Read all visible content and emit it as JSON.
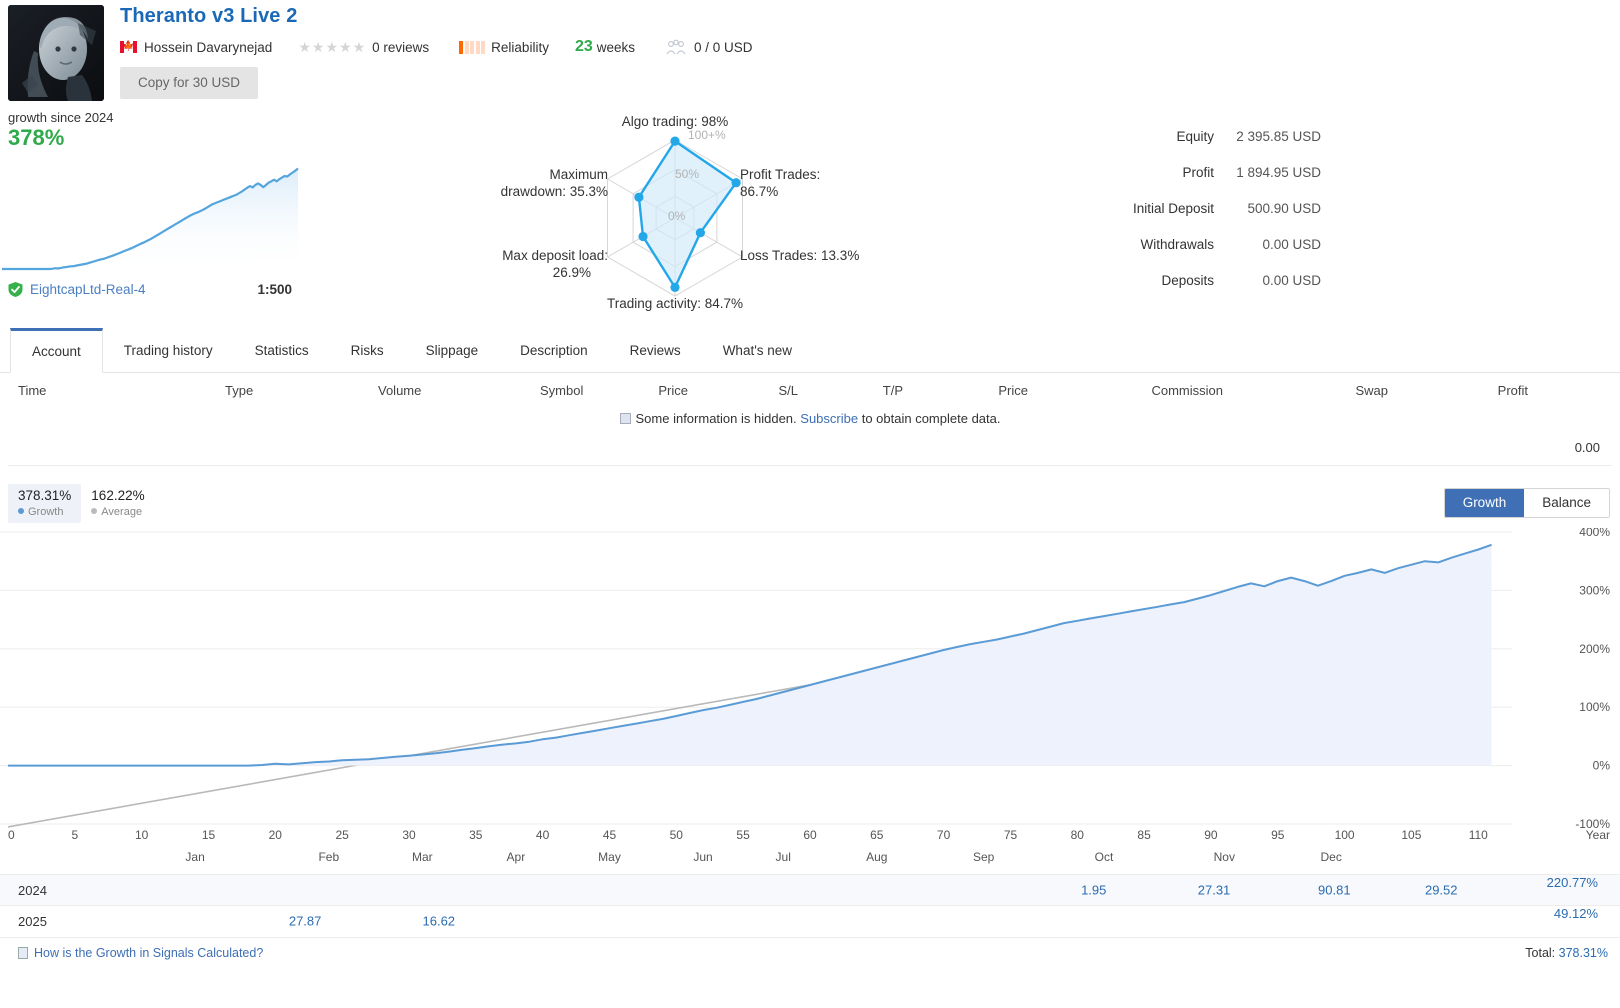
{
  "header": {
    "title": "Theranto v3 Live 2",
    "author": "Hossein Davarynejad",
    "country_flag": "canada-flag",
    "reviews": "0 reviews",
    "stars": 0,
    "reliability_label": "Reliability",
    "reliability_filled": 1,
    "reliability_total": 5,
    "weeks_number": "23",
    "weeks_label": "weeks",
    "subscribers": "0 / 0 USD",
    "copy_button": "Copy for 30 USD"
  },
  "growth_mini": {
    "caption": "growth since 2024",
    "value": "378%",
    "broker": "EightcapLtd-Real-4",
    "leverage": "1:500"
  },
  "radar": {
    "ring_labels": [
      "100+%",
      "50%",
      "0%"
    ],
    "axes": [
      {
        "name": "Algo trading",
        "label": "Algo trading: 98%",
        "value": 98
      },
      {
        "name": "Profit Trades",
        "label": "Profit Trades:",
        "label2": "86.7%",
        "value": 86.7
      },
      {
        "name": "Loss Trades",
        "label": "Loss Trades: 13.3%",
        "value": 13.3
      },
      {
        "name": "Trading activity",
        "label": "Trading activity: 84.7%",
        "value": 84.7
      },
      {
        "name": "Max deposit load",
        "label": "Max deposit load:",
        "label2": "26.9%",
        "value": 26.9
      },
      {
        "name": "Maximum drawdown",
        "label": "Maximum",
        "label2": "drawdown: 35.3%",
        "value": 35.3
      }
    ]
  },
  "equity": {
    "rows": [
      {
        "label": "Equity",
        "value": "2 395.85 USD",
        "pct": 100,
        "tone": "dark"
      },
      {
        "label": "Profit",
        "value": "1 894.95 USD",
        "pct": 72,
        "tone": "dark"
      },
      {
        "label": "Initial Deposit",
        "value": "500.90 USD",
        "pct": 20,
        "tone": "light"
      },
      {
        "label": "Withdrawals",
        "value": "0.00 USD",
        "pct": 0,
        "tone": "hair"
      },
      {
        "label": "Deposits",
        "value": "0.00 USD",
        "pct": 0,
        "tone": "hair"
      }
    ]
  },
  "tabs": {
    "items": [
      "Account",
      "Trading history",
      "Statistics",
      "Risks",
      "Slippage",
      "Description",
      "Reviews",
      "What's new"
    ],
    "active": "Account"
  },
  "trades_table": {
    "columns": [
      "Time",
      "Type",
      "Volume",
      "Symbol",
      "Price",
      "S/L",
      "T/P",
      "Price",
      "Commission",
      "Swap",
      "Profit"
    ],
    "hidden_note_pre": "Some information is hidden.",
    "hidden_note_link": "Subscribe",
    "hidden_note_post": "to obtain complete data.",
    "total_value": "0.00"
  },
  "growth_chart_controls": {
    "growth_value": "378.31%",
    "growth_name": "Growth",
    "average_value": "162.22%",
    "average_name": "Average",
    "toggle": [
      "Growth",
      "Balance"
    ],
    "toggle_active": "Growth"
  },
  "chart_data": {
    "type": "line",
    "title": "",
    "xlabel": "",
    "ylabel": "",
    "ylim": [
      -100,
      400
    ],
    "y_ticks": [
      "400%",
      "300%",
      "200%",
      "100%",
      "0%",
      "-100%"
    ],
    "y_tick_values": [
      400,
      300,
      200,
      100,
      0,
      -100
    ],
    "x_ticks": [
      "0",
      "5",
      "10",
      "15",
      "20",
      "25",
      "30",
      "35",
      "40",
      "45",
      "50",
      "55",
      "60",
      "65",
      "70",
      "75",
      "80",
      "85",
      "90",
      "95",
      "100",
      "105",
      "110"
    ],
    "x_tick_values": [
      0,
      5,
      10,
      15,
      20,
      25,
      30,
      35,
      40,
      45,
      50,
      55,
      60,
      65,
      70,
      75,
      80,
      85,
      90,
      95,
      100,
      105,
      110
    ],
    "x_axis_note": "Year",
    "month_ticks": [
      {
        "label": "Jan",
        "x": 14
      },
      {
        "label": "Feb",
        "x": 24
      },
      {
        "label": "Mar",
        "x": 31
      },
      {
        "label": "Apr",
        "x": 38
      },
      {
        "label": "May",
        "x": 45
      },
      {
        "label": "Jun",
        "x": 52
      },
      {
        "label": "Jul",
        "x": 58
      },
      {
        "label": "Aug",
        "x": 65
      },
      {
        "label": "Sep",
        "x": 73
      },
      {
        "label": "Oct",
        "x": 82
      },
      {
        "label": "Nov",
        "x": 91
      },
      {
        "label": "Dec",
        "x": 99
      }
    ],
    "grid": true,
    "legend": "top-left",
    "series": [
      {
        "name": "Growth",
        "color": "#5b9bd5",
        "x": [
          0,
          3,
          6,
          9,
          12,
          15,
          18,
          19,
          20,
          21,
          22,
          23,
          24,
          25,
          26,
          27,
          28,
          29,
          30,
          31,
          32,
          33,
          34,
          35,
          36,
          37,
          38,
          39,
          40,
          41,
          42,
          43,
          44,
          45,
          46,
          47,
          48,
          49,
          50,
          51,
          52,
          53,
          54,
          55,
          56,
          57,
          58,
          59,
          60,
          61,
          62,
          63,
          64,
          65,
          66,
          67,
          68,
          69,
          70,
          71,
          72,
          73,
          74,
          75,
          76,
          77,
          78,
          79,
          80,
          81,
          82,
          83,
          84,
          85,
          86,
          87,
          88,
          89,
          90,
          91,
          92,
          93,
          94,
          95,
          96,
          97,
          98,
          99,
          100,
          101,
          102,
          103,
          104,
          105,
          106,
          107,
          108,
          109,
          110,
          111
        ],
        "y": [
          0,
          0,
          0,
          0,
          0,
          0,
          0,
          1,
          3,
          2,
          4,
          6,
          7,
          9,
          10,
          11,
          13,
          15,
          17,
          19,
          21,
          24,
          27,
          30,
          33,
          36,
          38,
          41,
          45,
          48,
          52,
          56,
          60,
          64,
          68,
          72,
          76,
          80,
          85,
          90,
          95,
          99,
          104,
          109,
          114,
          120,
          126,
          132,
          138,
          144,
          150,
          156,
          162,
          168,
          174,
          180,
          186,
          192,
          198,
          203,
          208,
          212,
          216,
          221,
          226,
          232,
          238,
          244,
          248,
          252,
          256,
          260,
          264,
          268,
          272,
          276,
          280,
          286,
          292,
          299,
          306,
          312,
          307,
          316,
          322,
          316,
          308,
          316,
          325,
          330,
          336,
          330,
          338,
          344,
          350,
          348,
          356,
          363,
          370,
          378
        ]
      },
      {
        "name": "Average",
        "color": "#b9b9b9",
        "x": [
          0,
          111
        ],
        "y": [
          -105,
          345
        ]
      }
    ]
  },
  "year_table": {
    "month_columns": [
      "Jan",
      "Feb",
      "Mar",
      "Apr",
      "May",
      "Jun",
      "Jul",
      "Aug",
      "Sep",
      "Oct",
      "Nov",
      "Dec"
    ],
    "year_column_label": "Year",
    "rows": [
      {
        "year": "2024",
        "values": [
          "",
          "",
          "",
          "",
          "",
          "",
          "",
          "",
          "1.95",
          "27.31",
          "90.81",
          "29.52"
        ],
        "total": "220.77%"
      },
      {
        "year": "2025",
        "values": [
          "27.87",
          "16.62",
          "",
          "",
          "",
          "",
          "",
          "",
          "",
          "",
          "",
          ""
        ],
        "total": "49.12%"
      }
    ]
  },
  "footer": {
    "link": "How is the Growth in Signals Calculated?",
    "total_label": "Total:",
    "total_value": "378.31%"
  }
}
